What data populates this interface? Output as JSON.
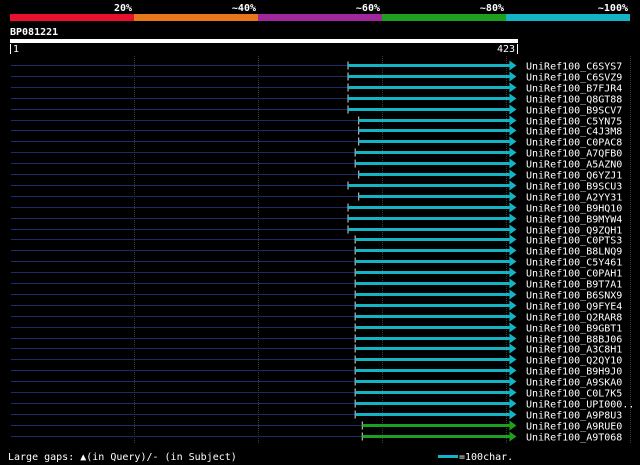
{
  "chart_data": {
    "type": "alignment",
    "query_id": "BP081221",
    "query_start": "1",
    "query_end": "423",
    "query_length": 423,
    "identity_legend": {
      "labels": [
        "20%",
        "~40%",
        "~60%",
        "~80%",
        "~100%"
      ],
      "colors": [
        "#e8102c",
        "#e8761c",
        "#a0289c",
        "#1ea01e",
        "#14b4c4"
      ]
    },
    "hits": [
      {
        "name": "UniRef100_C6SYS7",
        "start": 284,
        "end": 420,
        "identity_color": "#14b4c4"
      },
      {
        "name": "UniRef100_C6SVZ9",
        "start": 284,
        "end": 420,
        "identity_color": "#14b4c4"
      },
      {
        "name": "UniRef100_B7FJR4",
        "start": 284,
        "end": 420,
        "identity_color": "#14b4c4"
      },
      {
        "name": "UniRef100_Q8GT88",
        "start": 284,
        "end": 420,
        "identity_color": "#14b4c4"
      },
      {
        "name": "UniRef100_B9SCV7",
        "start": 284,
        "end": 420,
        "identity_color": "#14b4c4"
      },
      {
        "name": "UniRef100_C5YN75",
        "start": 293,
        "end": 420,
        "identity_color": "#14b4c4"
      },
      {
        "name": "UniRef100_C4J3M8",
        "start": 293,
        "end": 420,
        "identity_color": "#14b4c4"
      },
      {
        "name": "UniRef100_C0PAC8",
        "start": 293,
        "end": 420,
        "identity_color": "#14b4c4"
      },
      {
        "name": "UniRef100_A7QFB0",
        "start": 290,
        "end": 420,
        "identity_color": "#14b4c4"
      },
      {
        "name": "UniRef100_A5AZN0",
        "start": 290,
        "end": 420,
        "identity_color": "#14b4c4"
      },
      {
        "name": "UniRef100_Q6YZJ1",
        "start": 293,
        "end": 420,
        "identity_color": "#14b4c4"
      },
      {
        "name": "UniRef100_B9SCU3",
        "start": 284,
        "end": 420,
        "identity_color": "#14b4c4"
      },
      {
        "name": "UniRef100_A2YY31",
        "start": 293,
        "end": 420,
        "identity_color": "#14b4c4"
      },
      {
        "name": "UniRef100_B9HQ10",
        "start": 284,
        "end": 420,
        "identity_color": "#14b4c4"
      },
      {
        "name": "UniRef100_B9MYW4",
        "start": 284,
        "end": 420,
        "identity_color": "#14b4c4"
      },
      {
        "name": "UniRef100_Q9ZQH1",
        "start": 284,
        "end": 420,
        "identity_color": "#14b4c4"
      },
      {
        "name": "UniRef100_C0PTS3",
        "start": 290,
        "end": 420,
        "identity_color": "#14b4c4"
      },
      {
        "name": "UniRef100_B8LNQ9",
        "start": 290,
        "end": 420,
        "identity_color": "#14b4c4"
      },
      {
        "name": "UniRef100_C5Y461",
        "start": 290,
        "end": 420,
        "identity_color": "#14b4c4"
      },
      {
        "name": "UniRef100_C0PAH1",
        "start": 290,
        "end": 420,
        "identity_color": "#14b4c4"
      },
      {
        "name": "UniRef100_B9T7A1",
        "start": 290,
        "end": 420,
        "identity_color": "#14b4c4"
      },
      {
        "name": "UniRef100_B6SNX9",
        "start": 290,
        "end": 420,
        "identity_color": "#14b4c4"
      },
      {
        "name": "UniRef100_Q9FYE4",
        "start": 290,
        "end": 420,
        "identity_color": "#14b4c4"
      },
      {
        "name": "UniRef100_Q2RAR8",
        "start": 290,
        "end": 420,
        "identity_color": "#14b4c4"
      },
      {
        "name": "UniRef100_B9GBT1",
        "start": 290,
        "end": 420,
        "identity_color": "#14b4c4"
      },
      {
        "name": "UniRef100_B8BJ06",
        "start": 290,
        "end": 420,
        "identity_color": "#14b4c4"
      },
      {
        "name": "UniRef100_A3C8H1",
        "start": 290,
        "end": 420,
        "identity_color": "#14b4c4"
      },
      {
        "name": "UniRef100_Q2QY10",
        "start": 290,
        "end": 420,
        "identity_color": "#14b4c4"
      },
      {
        "name": "UniRef100_B9H9J0",
        "start": 290,
        "end": 420,
        "identity_color": "#14b4c4"
      },
      {
        "name": "UniRef100_A9SKA0",
        "start": 290,
        "end": 420,
        "identity_color": "#14b4c4"
      },
      {
        "name": "UniRef100_C0L7K5",
        "start": 290,
        "end": 420,
        "identity_color": "#14b4c4"
      },
      {
        "name": "UniRef100_UPI000..",
        "start": 290,
        "end": 420,
        "identity_color": "#14b4c4"
      },
      {
        "name": "UniRef100_A9P8U3",
        "start": 290,
        "end": 420,
        "identity_color": "#14b4c4"
      },
      {
        "name": "UniRef100_A9RUE0",
        "start": 296,
        "end": 420,
        "identity_color": "#1ea01e"
      },
      {
        "name": "UniRef100_A9T068",
        "start": 296,
        "end": 420,
        "identity_color": "#1ea01e"
      }
    ],
    "footer_gaps_text": "Large gaps: ▲(in Query)/- (in Subject)",
    "scale_text": "=100char."
  }
}
